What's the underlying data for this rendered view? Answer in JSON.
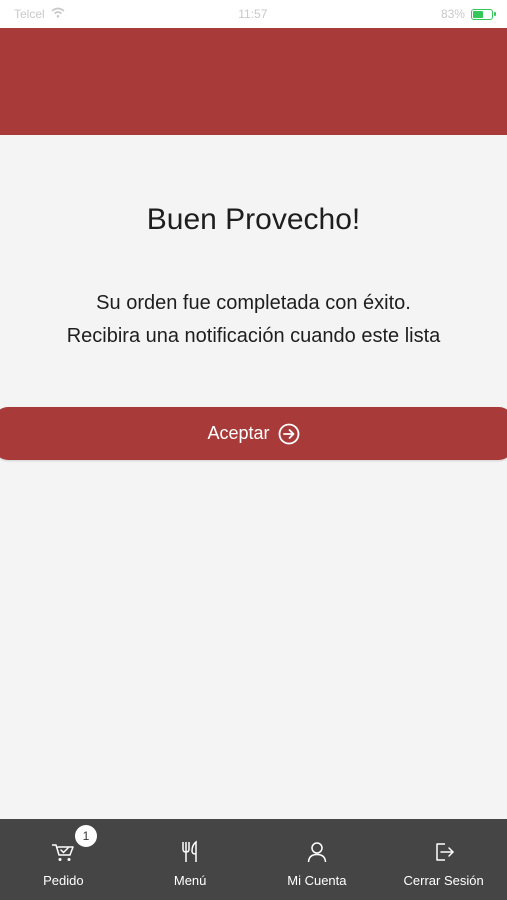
{
  "status_bar": {
    "carrier": "Telcel",
    "time": "11:57",
    "battery_percent": "83%",
    "battery_level": 0.83,
    "wifi_icon": "wifi-icon"
  },
  "content": {
    "title": "Buen Provecho!",
    "message_line1": "Su orden fue completada con éxito.",
    "message_line2": "Recibira una notificación cuando este lista",
    "accept_button": {
      "label": "Aceptar",
      "icon": "arrow-right-circle-icon"
    }
  },
  "tabbar": {
    "tabs": [
      {
        "label": "Pedido",
        "icon": "cart-icon",
        "badge": "1"
      },
      {
        "label": "Menú",
        "icon": "utensils-icon"
      },
      {
        "label": "Mi Cuenta",
        "icon": "user-icon"
      },
      {
        "label": "Cerrar Sesión",
        "icon": "logout-icon"
      }
    ]
  },
  "colors": {
    "brand": "#a83b3a",
    "tabbar_bg": "#454545",
    "page_bg": "#f4f4f4",
    "text": "#1e1e1e"
  }
}
